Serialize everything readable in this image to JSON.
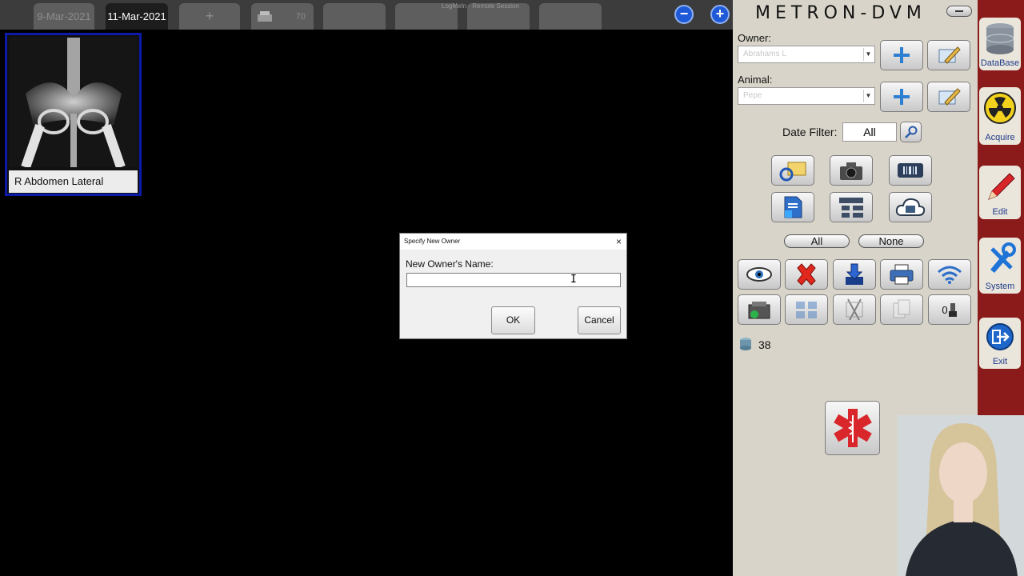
{
  "tabs": [
    {
      "label": "9-Mar-2021",
      "active": false
    },
    {
      "label": "11-Mar-2021",
      "active": true
    },
    {
      "label": "+",
      "active": false
    },
    {
      "label": "70",
      "active": false
    }
  ],
  "remote_session_label": "LogMeIn - Remote Session",
  "zoom_buttons": {
    "minus": "−",
    "plus": "+"
  },
  "brand": "METRON-DVM",
  "owner": {
    "label": "Owner:",
    "value": "Abrahams L"
  },
  "animal": {
    "label": "Animal:",
    "value": "Pepe"
  },
  "date_filter": {
    "label": "Date Filter:",
    "value": "All"
  },
  "selection": {
    "all": "All",
    "none": "None"
  },
  "counter_value": "38",
  "print_counter": "0",
  "nav": {
    "database": "DataBase",
    "acquire": "Acquire",
    "edit": "Edit",
    "system": "System",
    "exit": "Exit"
  },
  "thumbnail": {
    "caption": "R Abdomen Lateral"
  },
  "dialog": {
    "title": "Specify New Owner",
    "close": "×",
    "label": "New Owner's Name:",
    "input_value": "",
    "ok": "OK",
    "cancel": "Cancel"
  },
  "colors": {
    "accent_blue": "#1e5ad8",
    "nav_red": "#8b1b1b",
    "panel_bg": "#d8d4c9",
    "selection_border": "#0b1aa8"
  }
}
